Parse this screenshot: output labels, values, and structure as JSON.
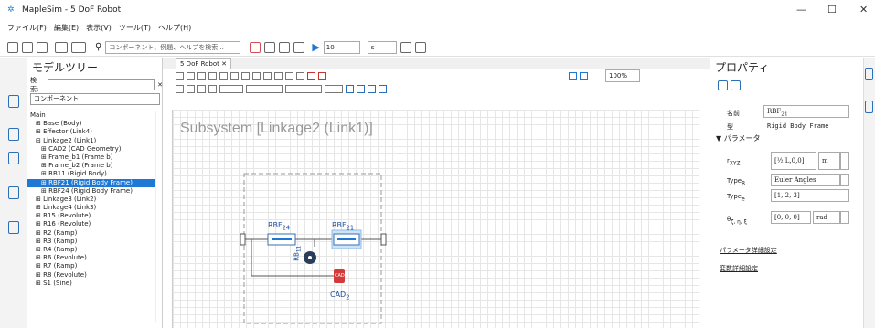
{
  "window": {
    "title": "MapleSim - 5 DoF Robot",
    "minimize": "—",
    "maximize": "☐",
    "close": "✕"
  },
  "menu": [
    "ファイル(F)",
    "編集(E)",
    "表示(V)",
    "ツール(T)",
    "ヘルプ(H)"
  ],
  "toolbar": {
    "search_placeholder": "コンポーネント、例題、ヘルプを検索...",
    "zoom_value": "10",
    "unit": "s"
  },
  "tree": {
    "title": "モデルツリー",
    "search_label": "検索:",
    "filter": "コンポーネント",
    "items": [
      {
        "label": "Main",
        "indent": 0,
        "selected": false
      },
      {
        "label": "⊞ Base (Body)",
        "indent": 1,
        "selected": false
      },
      {
        "label": "⊞ Effector (Link4)",
        "indent": 1,
        "selected": false
      },
      {
        "label": "⊟ Linkage2 (Link1)",
        "indent": 1,
        "selected": false
      },
      {
        "label": "⊞ CAD2 (CAD Geometry)",
        "indent": 2,
        "selected": false
      },
      {
        "label": "⊞ Frame_b1 (Frame b)",
        "indent": 2,
        "selected": false
      },
      {
        "label": "⊞ Frame_b2 (Frame b)",
        "indent": 2,
        "selected": false
      },
      {
        "label": "⊞ RB11 (Rigid Body)",
        "indent": 2,
        "selected": false
      },
      {
        "label": "⊞ RBF21 (Rigid Body Frame)",
        "indent": 2,
        "selected": true
      },
      {
        "label": "⊞ RBF24 (Rigid Body Frame)",
        "indent": 2,
        "selected": false
      },
      {
        "label": "⊞ Linkage3 (Link2)",
        "indent": 1,
        "selected": false
      },
      {
        "label": "⊞ Linkage4 (Link3)",
        "indent": 1,
        "selected": false
      },
      {
        "label": "⊞ R15 (Revolute)",
        "indent": 1,
        "selected": false
      },
      {
        "label": "⊞ R16 (Revolute)",
        "indent": 1,
        "selected": false
      },
      {
        "label": "⊞ R2 (Ramp)",
        "indent": 1,
        "selected": false
      },
      {
        "label": "⊞ R3 (Ramp)",
        "indent": 1,
        "selected": false
      },
      {
        "label": "⊞ R4 (Ramp)",
        "indent": 1,
        "selected": false
      },
      {
        "label": "⊞ R6 (Revolute)",
        "indent": 1,
        "selected": false
      },
      {
        "label": "⊞ R7 (Ramp)",
        "indent": 1,
        "selected": false
      },
      {
        "label": "⊞ R8 (Revolute)",
        "indent": 1,
        "selected": false
      },
      {
        "label": "⊞ S1 (Sine)",
        "indent": 1,
        "selected": false
      }
    ]
  },
  "editor": {
    "tab": "5 DoF Robot",
    "tab_close": "✕",
    "subsystem_title": "Subsystem [Linkage2 (Link1)]",
    "zoom": "100%",
    "labels": {
      "rbf24": "RBF",
      "rbf24_sub": "24",
      "rbf21": "RBF",
      "rbf21_sub": "21",
      "rb": "RB",
      "rb_sub": "11",
      "cad": "CAD",
      "cad_sub": "2",
      "cad_text": "CAD"
    }
  },
  "props": {
    "title": "プロパティ",
    "name_label": "名前",
    "name_value": "RBF",
    "name_sub": "21",
    "type_label": "型",
    "type_value": "Rigid Body Frame",
    "section": "パラメータ",
    "r_label": "r",
    "r_sub": "XYZ",
    "r_value": "[½ L,0,0]",
    "r_unit": "m",
    "typeR_label": "Type",
    "typeR_sub": "R",
    "typeR_value": "Euler Angles",
    "typeE_label": "Type",
    "typeE_sub": "e",
    "typeE_value": "[1, 2, 3]",
    "theta_label": "θ",
    "theta_sub": "ζ, η, ξ",
    "theta_value": "[0, 0, 0]",
    "theta_unit": "rad",
    "link1": "パラメータ詳細設定",
    "link2": "変数詳細設定"
  }
}
